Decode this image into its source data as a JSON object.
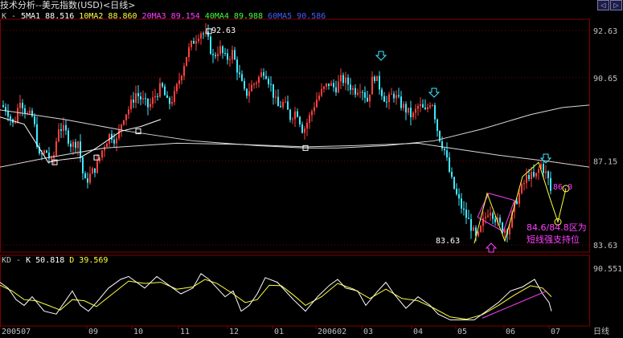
{
  "window": {
    "title": "技术分析--美元指数(USD)<日线>"
  },
  "nav_buttons": [
    "◁",
    "▷"
  ],
  "colors": {
    "up": "#ff4040",
    "down": "#40e8ff",
    "ma_short": "#ffffff",
    "ma_long": "#d8d8d8",
    "k_line": "#ffffff",
    "d_line": "#ffff40",
    "annot_pink": "#ff40ff",
    "annot_yellow": "#ffff40",
    "grid": "#800000",
    "text": "#c0c0c0"
  },
  "legend_main": [
    {
      "text": "K -",
      "color": "#c0c0c0"
    },
    {
      "text": "5MA1  88.516",
      "color": "#ffffff"
    },
    {
      "text": "10MA2  88.860",
      "color": "#ffff40"
    },
    {
      "text": "20MA3  89.154",
      "color": "#ff40ff"
    },
    {
      "text": "40MA4  89.988",
      "color": "#40ff40"
    },
    {
      "text": "60MA5  90.586",
      "color": "#4060ff"
    }
  ],
  "legend_kd": [
    {
      "text": "KD -",
      "color": "#c0c0c0"
    },
    {
      "text": "K 50.818",
      "color": "#ffffff"
    },
    {
      "text": "D  39.569",
      "color": "#ffff40"
    }
  ],
  "chart_data": {
    "type": "candlestick",
    "title": "美元指数(USD) 日线",
    "xlabel": "日线",
    "x_ticks": [
      "200507",
      "09",
      "10",
      "11",
      "12",
      "01",
      "200602",
      "03",
      "04",
      "05",
      "06",
      "07"
    ],
    "y_ticks": [
      "92.63",
      "90.65",
      "87.15",
      "83.63"
    ],
    "ylim": [
      83.4,
      93.0
    ],
    "kd_ylim": [
      0,
      100
    ],
    "kd_y_ticks": [
      "90.551"
    ],
    "close_path": [
      [
        0,
        89.5
      ],
      [
        8,
        89.3
      ],
      [
        16,
        88.6
      ],
      [
        24,
        89.8
      ],
      [
        32,
        89.1
      ],
      [
        40,
        89.0
      ],
      [
        48,
        87.3
      ],
      [
        56,
        87.6
      ],
      [
        64,
        87.0
      ],
      [
        72,
        88.6
      ],
      [
        80,
        88.4
      ],
      [
        88,
        87.8
      ],
      [
        96,
        88.0
      ],
      [
        104,
        86.2
      ],
      [
        112,
        86.6
      ],
      [
        120,
        87.0
      ],
      [
        128,
        87.8
      ],
      [
        136,
        88.3
      ],
      [
        144,
        88.0
      ],
      [
        152,
        89.0
      ],
      [
        160,
        89.4
      ],
      [
        168,
        90.0
      ],
      [
        176,
        89.7
      ],
      [
        184,
        89.4
      ],
      [
        192,
        89.9
      ],
      [
        200,
        90.3
      ],
      [
        208,
        89.5
      ],
      [
        216,
        89.9
      ],
      [
        224,
        90.8
      ],
      [
        232,
        91.7
      ],
      [
        240,
        92.2
      ],
      [
        248,
        92.6
      ],
      [
        256,
        92.4
      ],
      [
        264,
        91.5
      ],
      [
        272,
        91.9
      ],
      [
        280,
        91.4
      ],
      [
        288,
        91.7
      ],
      [
        296,
        90.8
      ],
      [
        304,
        89.9
      ],
      [
        312,
        90.3
      ],
      [
        320,
        90.6
      ],
      [
        328,
        91.0
      ],
      [
        336,
        90.3
      ],
      [
        344,
        89.4
      ],
      [
        352,
        89.6
      ],
      [
        360,
        89.0
      ],
      [
        368,
        89.3
      ],
      [
        376,
        88.4
      ],
      [
        384,
        89.0
      ],
      [
        392,
        89.7
      ],
      [
        400,
        90.1
      ],
      [
        408,
        90.4
      ],
      [
        416,
        90.2
      ],
      [
        424,
        90.6
      ],
      [
        432,
        90.4
      ],
      [
        440,
        90.1
      ],
      [
        448,
        90.3
      ],
      [
        456,
        89.7
      ],
      [
        464,
        90.8
      ],
      [
        472,
        90.2
      ],
      [
        480,
        89.6
      ],
      [
        488,
        90.0
      ],
      [
        496,
        89.6
      ],
      [
        504,
        89.3
      ],
      [
        512,
        89.0
      ],
      [
        520,
        89.5
      ],
      [
        528,
        89.2
      ],
      [
        536,
        89.8
      ],
      [
        544,
        88.3
      ],
      [
        552,
        87.6
      ],
      [
        560,
        86.4
      ],
      [
        568,
        85.6
      ],
      [
        576,
        85.0
      ],
      [
        584,
        84.5
      ],
      [
        592,
        83.8
      ],
      [
        600,
        84.6
      ],
      [
        608,
        85.2
      ],
      [
        616,
        84.7
      ],
      [
        624,
        84.3
      ],
      [
        632,
        84.3
      ],
      [
        640,
        85.4
      ],
      [
        648,
        86.0
      ],
      [
        656,
        86.6
      ],
      [
        664,
        86.4
      ],
      [
        672,
        87.0
      ],
      [
        680,
        86.5
      ],
      [
        686,
        85.6
      ]
    ],
    "ma_short_path": [
      [
        0,
        89.0
      ],
      [
        30,
        88.7
      ],
      [
        60,
        87.1
      ],
      [
        75,
        87.2
      ],
      [
        100,
        87.3
      ],
      [
        120,
        87.7
      ],
      [
        150,
        88.4
      ],
      [
        175,
        88.6
      ],
      [
        200,
        88.9
      ]
    ],
    "ma_long_path": [
      [
        0,
        89.3
      ],
      [
        80,
        88.9
      ],
      [
        160,
        88.4
      ],
      [
        240,
        88.0
      ],
      [
        320,
        87.8
      ],
      [
        380,
        87.7
      ],
      [
        420,
        87.7
      ],
      [
        480,
        87.8
      ],
      [
        540,
        88.0
      ],
      [
        600,
        88.5
      ],
      [
        660,
        89.1
      ],
      [
        700,
        89.4
      ],
      [
        733,
        89.5
      ]
    ],
    "ma_cross_path": [
      [
        0,
        86.9
      ],
      [
        60,
        87.3
      ],
      [
        130,
        87.7
      ],
      [
        220,
        87.9
      ],
      [
        300,
        87.85
      ],
      [
        380,
        87.75
      ],
      [
        440,
        87.8
      ],
      [
        520,
        87.9
      ],
      [
        560,
        87.7
      ],
      [
        620,
        87.4
      ],
      [
        680,
        87.15
      ],
      [
        733,
        86.9
      ]
    ],
    "k_path": [
      [
        0,
        70
      ],
      [
        10,
        60
      ],
      [
        20,
        40
      ],
      [
        30,
        30
      ],
      [
        40,
        45
      ],
      [
        55,
        20
      ],
      [
        70,
        15
      ],
      [
        80,
        35
      ],
      [
        90,
        55
      ],
      [
        100,
        30
      ],
      [
        110,
        20
      ],
      [
        120,
        35
      ],
      [
        135,
        60
      ],
      [
        150,
        75
      ],
      [
        160,
        80
      ],
      [
        170,
        70
      ],
      [
        180,
        60
      ],
      [
        195,
        80
      ],
      [
        210,
        65
      ],
      [
        225,
        50
      ],
      [
        240,
        60
      ],
      [
        250,
        85
      ],
      [
        260,
        75
      ],
      [
        270,
        60
      ],
      [
        280,
        45
      ],
      [
        290,
        55
      ],
      [
        300,
        20
      ],
      [
        310,
        30
      ],
      [
        320,
        50
      ],
      [
        330,
        78
      ],
      [
        345,
        70
      ],
      [
        355,
        55
      ],
      [
        365,
        40
      ],
      [
        380,
        20
      ],
      [
        395,
        45
      ],
      [
        410,
        65
      ],
      [
        420,
        75
      ],
      [
        430,
        60
      ],
      [
        445,
        55
      ],
      [
        455,
        30
      ],
      [
        470,
        55
      ],
      [
        480,
        70
      ],
      [
        490,
        50
      ],
      [
        505,
        25
      ],
      [
        520,
        45
      ],
      [
        535,
        30
      ],
      [
        545,
        15
      ],
      [
        560,
        5
      ],
      [
        575,
        5
      ],
      [
        590,
        5
      ],
      [
        605,
        20
      ],
      [
        620,
        35
      ],
      [
        635,
        55
      ],
      [
        650,
        62
      ],
      [
        665,
        75
      ],
      [
        675,
        50
      ],
      [
        683,
        35
      ],
      [
        686,
        20
      ]
    ],
    "d_path": [
      [
        0,
        65
      ],
      [
        15,
        55
      ],
      [
        30,
        40
      ],
      [
        45,
        38
      ],
      [
        60,
        30
      ],
      [
        75,
        22
      ],
      [
        90,
        40
      ],
      [
        105,
        38
      ],
      [
        120,
        28
      ],
      [
        140,
        50
      ],
      [
        160,
        72
      ],
      [
        180,
        68
      ],
      [
        200,
        70
      ],
      [
        220,
        58
      ],
      [
        240,
        62
      ],
      [
        255,
        75
      ],
      [
        270,
        68
      ],
      [
        290,
        50
      ],
      [
        305,
        35
      ],
      [
        320,
        40
      ],
      [
        335,
        65
      ],
      [
        350,
        64
      ],
      [
        365,
        48
      ],
      [
        380,
        30
      ],
      [
        400,
        45
      ],
      [
        420,
        68
      ],
      [
        440,
        58
      ],
      [
        460,
        42
      ],
      [
        480,
        58
      ],
      [
        500,
        42
      ],
      [
        520,
        38
      ],
      [
        540,
        25
      ],
      [
        560,
        10
      ],
      [
        580,
        6
      ],
      [
        600,
        14
      ],
      [
        620,
        30
      ],
      [
        640,
        48
      ],
      [
        660,
        64
      ],
      [
        675,
        60
      ],
      [
        686,
        45
      ]
    ],
    "annotations": {
      "high_label": "92.63",
      "low_label": "83.63",
      "target_label": "86.0",
      "support_text_1": "84.6/84.8区为",
      "support_text_2": "短线强支持位"
    },
    "triangle_pink": [
      [
        594,
        84.8
      ],
      [
        608,
        85.8
      ],
      [
        640,
        85.5
      ],
      [
        626,
        84.2
      ]
    ],
    "wave_yellow": [
      [
        590,
        83.7
      ],
      [
        606,
        85.8
      ],
      [
        628,
        83.8
      ],
      [
        650,
        86.5
      ],
      [
        670,
        87.1
      ],
      [
        684,
        85.6
      ],
      [
        694,
        84.6
      ],
      [
        704,
        86.0
      ]
    ]
  }
}
